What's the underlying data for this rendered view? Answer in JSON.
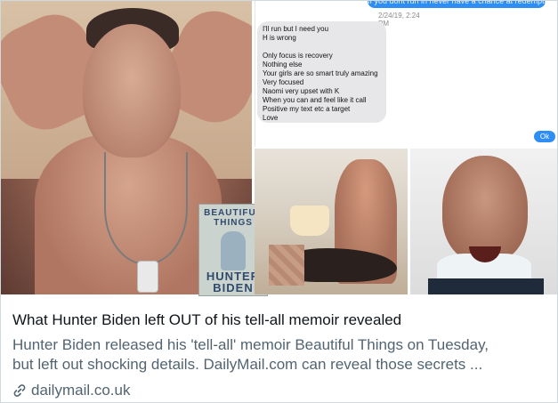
{
  "card": {
    "title": "What Hunter Biden left OUT of his tell-all memoir revealed",
    "description_lines": [
      "Hunter Biden released his 'tell-all' memoir Beautiful Things on Tuesday,",
      "but left out shocking details. DailyMail.com can reveal those secrets ..."
    ],
    "domain": "dailymail.co.uk",
    "link_icon": "link-icon"
  },
  "book": {
    "title_line1": "BEAUTIFUL",
    "title_line2": "THINGS",
    "author_line1": "HUNTER",
    "author_line2": "BIDEN"
  },
  "chat": {
    "outgoing_text": "If you dont run in never have a chance at redemption",
    "timestamp": "2/24/19, 2:24 PM",
    "incoming_lines": [
      "I'll run but I need you",
      "H is wrong",
      "",
      "Only focus is recovery",
      "Nothing else",
      "Your girls are so smart truly amazing",
      "Very focused",
      "Naomi very upset with K",
      "When you can and feel like it call",
      "Positive my text etc a target",
      "Love"
    ],
    "ok_button": "Ok",
    "outgoing_color": "#2f8ef3",
    "incoming_color": "#e7e7ea"
  }
}
